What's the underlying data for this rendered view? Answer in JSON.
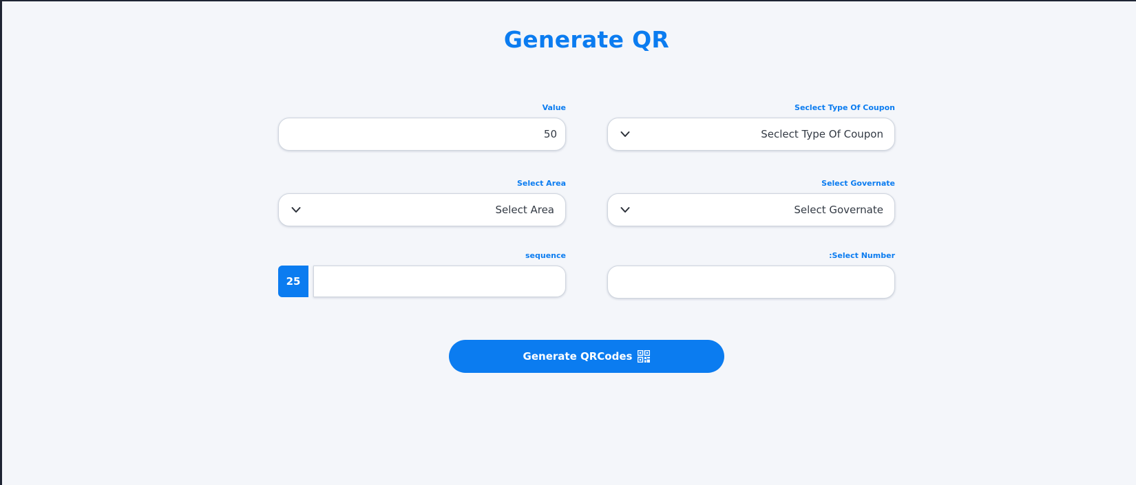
{
  "page": {
    "title": "Generate QR"
  },
  "form": {
    "value": {
      "label": "Value",
      "current_value": "50"
    },
    "coupon_type": {
      "label": "Seclect Type Of Coupon",
      "selected": "Seclect Type Of Coupon",
      "icon": "chevron-down-icon"
    },
    "area": {
      "label": "Select Area",
      "selected": "Select Area",
      "icon": "chevron-down-icon"
    },
    "governate": {
      "label": "Select Governate",
      "selected": "Select Governate",
      "icon": "chevron-down-icon"
    },
    "sequence": {
      "label": "sequence",
      "badge": "25",
      "current_value": ""
    },
    "number": {
      "label": ":Select Number",
      "current_value": ""
    }
  },
  "actions": {
    "generate_label": "Generate QRCodes",
    "generate_icon": "qr-code-icon"
  },
  "colors": {
    "accent": "#0b7cf0",
    "background": "#f4f6fa",
    "field_border": "#cfd5de"
  }
}
